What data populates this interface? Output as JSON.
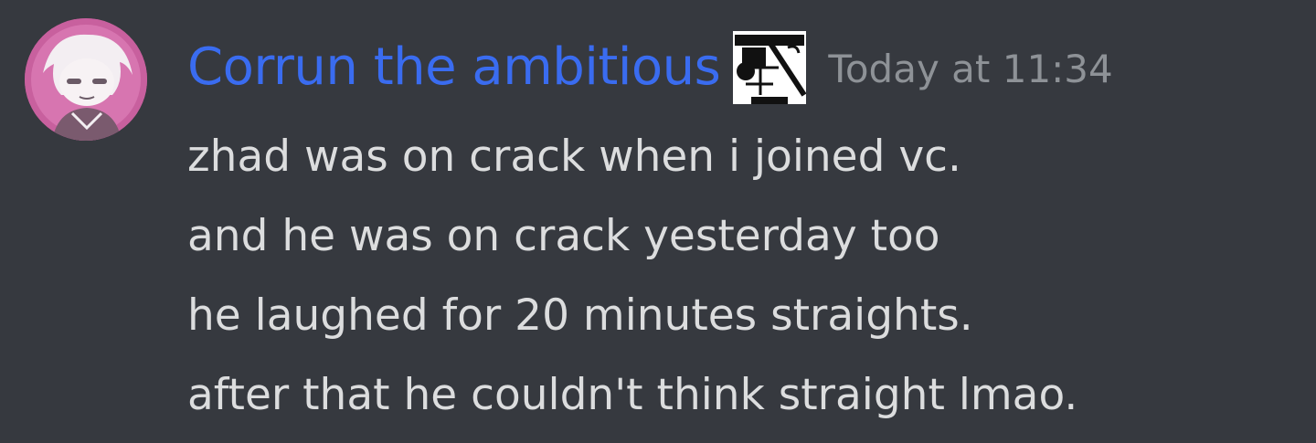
{
  "message": {
    "author": "Corrun the ambitious",
    "author_color": "#3a6cf0",
    "timestamp": "Today at 11:34",
    "avatar_icon": "user-avatar",
    "role_icon": "custom-emoji-icon",
    "lines": [
      "zhad was on crack when i joined vc.",
      "and he was on crack yesterday too",
      "he laughed for 20 minutes straights.",
      "after that he couldn't think straight lmao."
    ]
  },
  "colors": {
    "background": "#36393f",
    "text": "#dcddde",
    "muted": "#8e9297"
  }
}
